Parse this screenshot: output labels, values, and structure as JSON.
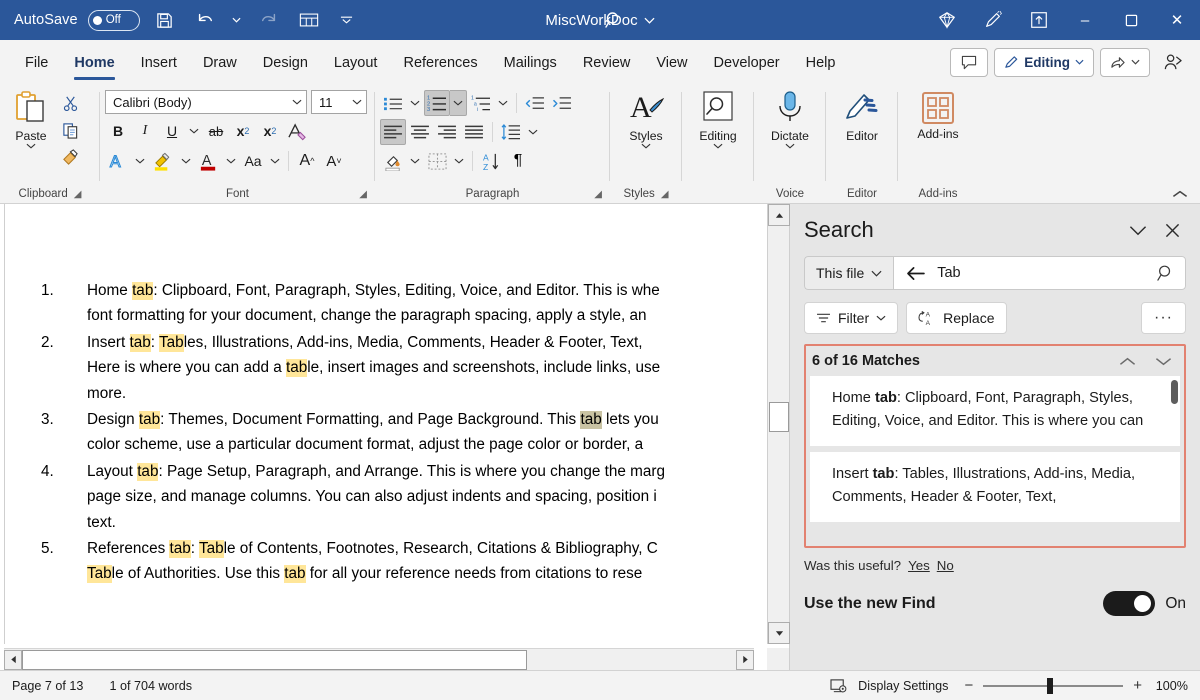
{
  "titlebar": {
    "autosave_label": "AutoSave",
    "autosave_state": "Off",
    "document_title": "MiscWorkDoc",
    "icons": [
      "save-icon",
      "undo-icon",
      "redo-icon",
      "table-icon",
      "customize-quick-access-toolbar-icon"
    ],
    "search_icon": "search-icon",
    "right_icons": [
      "diamond-icon",
      "pen-highlight-icon",
      "share-upload-icon"
    ],
    "window_minimize": "–",
    "window_maximize": "▫",
    "window_close": "✕"
  },
  "tabs": [
    {
      "label": "File",
      "active": false
    },
    {
      "label": "Home",
      "active": true
    },
    {
      "label": "Insert",
      "active": false
    },
    {
      "label": "Draw",
      "active": false
    },
    {
      "label": "Design",
      "active": false
    },
    {
      "label": "Layout",
      "active": false
    },
    {
      "label": "References",
      "active": false
    },
    {
      "label": "Mailings",
      "active": false
    },
    {
      "label": "Review",
      "active": false
    },
    {
      "label": "View",
      "active": false
    },
    {
      "label": "Developer",
      "active": false
    },
    {
      "label": "Help",
      "active": false
    }
  ],
  "tabstrip_right": {
    "comments_icon": "comment-icon",
    "editing_label": "Editing",
    "editing_icon": "pencil-icon",
    "share_icon": "share-icon",
    "catchup_icon": "person-add-icon"
  },
  "ribbon": {
    "groups": [
      {
        "name": "Clipboard",
        "label": "Clipboard",
        "has_dialog_launcher": true
      },
      {
        "name": "Font",
        "label": "Font",
        "has_dialog_launcher": true
      },
      {
        "name": "Paragraph",
        "label": "Paragraph",
        "has_dialog_launcher": true
      },
      {
        "name": "Styles",
        "label": "Styles",
        "has_dialog_launcher": true
      },
      {
        "name": "Editing",
        "label": "",
        "has_dialog_launcher": false
      },
      {
        "name": "Voice",
        "label": "Voice",
        "has_dialog_launcher": false
      },
      {
        "name": "Editor",
        "label": "Editor",
        "has_dialog_launcher": false
      },
      {
        "name": "Add-ins",
        "label": "Add-ins",
        "has_dialog_launcher": false
      }
    ],
    "clipboard": {
      "paste_label": "Paste",
      "cut_icon": "scissors-icon",
      "copy_icon": "copy-icon",
      "format_painter_icon": "format-painter-icon"
    },
    "font": {
      "font_name": "Calibri (Body)",
      "font_size": "11",
      "bold": "B",
      "italic": "I",
      "underline": "U",
      "strikethrough": "ab",
      "subscript": "x",
      "superscript": "x",
      "clear_formatting_icon": "clear-formatting-icon",
      "text_effects_icon": "text-effects-icon",
      "highlight_icon": "text-highlight-icon",
      "font_color_icon": "font-color-icon",
      "change_case": "Aa",
      "grow_font": "A",
      "shrink_font": "A"
    },
    "paragraph": {
      "bullets_icon": "bullet-list-icon",
      "numbering_icon": "numbered-list-icon",
      "multilevel_icon": "multilevel-list-icon",
      "decrease_indent_icon": "decrease-indent-icon",
      "increase_indent_icon": "increase-indent-icon",
      "align_left_icon": "align-left-icon",
      "align_center_icon": "align-center-icon",
      "align_right_icon": "align-right-icon",
      "justify_icon": "justify-icon",
      "line_spacing_icon": "line-spacing-icon",
      "shading_icon": "shading-icon",
      "borders_icon": "borders-icon",
      "sort_icon": "sort-icon",
      "show_marks_icon": "paragraph-marks-icon"
    },
    "styles": {
      "label": "Styles",
      "icon": "styles-icon"
    },
    "editing": {
      "label": "Editing",
      "icon": "find-icon"
    },
    "voice": {
      "label": "Dictate",
      "icon": "microphone-icon"
    },
    "editor": {
      "label": "Editor",
      "icon": "editor-pen-icon"
    },
    "addins": {
      "label": "Add-ins",
      "icon": "addins-grid-icon"
    },
    "collapse_icon": "collapse-ribbon-icon"
  },
  "document": {
    "items": [
      [
        {
          "t": "Home "
        },
        {
          "t": "tab",
          "hl": "match"
        },
        {
          "t": ": Clipboard, Font, Paragraph, Styles, Editing, Voice, and Editor. This is whe"
        },
        {
          "t": "\n"
        },
        {
          "t": "font formatting for your document, change the paragraph spacing, apply a style, an"
        }
      ],
      [
        {
          "t": "Insert "
        },
        {
          "t": "tab",
          "hl": "match"
        },
        {
          "t": ": "
        },
        {
          "t": "Tab",
          "hl": "match"
        },
        {
          "t": "les, Illustrations, Add-ins, Media, Comments, Header & Footer, Text,"
        },
        {
          "t": "\n"
        },
        {
          "t": "Here is where you can add a "
        },
        {
          "t": "tab",
          "hl": "match"
        },
        {
          "t": "le, insert images and screenshots, include links, use"
        },
        {
          "t": "\n"
        },
        {
          "t": "more."
        }
      ],
      [
        {
          "t": "Design "
        },
        {
          "t": "tab",
          "hl": "match"
        },
        {
          "t": ": Themes, Document Formatting, and Page Background. This "
        },
        {
          "t": "tab",
          "hl": "selected"
        },
        {
          "t": " lets you"
        },
        {
          "t": "\n"
        },
        {
          "t": "color scheme, use a particular document format, adjust the page color or border, a"
        }
      ],
      [
        {
          "t": "Layout "
        },
        {
          "t": "tab",
          "hl": "match"
        },
        {
          "t": ": Page Setup, Paragraph, and Arrange. This is where you change the marg"
        },
        {
          "t": "\n"
        },
        {
          "t": "page size, and manage columns. You can also adjust indents and spacing, position i"
        },
        {
          "t": "\n"
        },
        {
          "t": "text."
        }
      ],
      [
        {
          "t": "References "
        },
        {
          "t": "tab",
          "hl": "match"
        },
        {
          "t": ": "
        },
        {
          "t": "Tab",
          "hl": "match"
        },
        {
          "t": "le of Contents, Footnotes, Research, Citations & Bibliography, C"
        },
        {
          "t": "\n"
        },
        {
          "t": "Tab",
          "hl": "match"
        },
        {
          "t": "le of Authorities. Use this "
        },
        {
          "t": "tab",
          "hl": "match"
        },
        {
          "t": " for all your reference needs from citations to rese"
        }
      ]
    ]
  },
  "search_pane": {
    "title": "Search",
    "collapse_icon": "chevron-down-icon",
    "close_icon": "close-icon",
    "scope_label": "This file",
    "scope_caret_icon": "chevron-down-icon",
    "back_icon": "arrow-left-icon",
    "query_value": "Tab",
    "query_placeholder": "Search",
    "search_icon": "search-icon",
    "filter_label": "Filter",
    "filter_icon": "filter-icon",
    "replace_label": "Replace",
    "replace_icon": "replace-icon",
    "more_label": "···",
    "match_count_label": "6 of 16 Matches",
    "prev_icon": "chevron-up-icon",
    "next_icon": "chevron-down-icon",
    "results": [
      {
        "prefix": "Home ",
        "bold": "tab",
        "suffix": ": Clipboard, Font, Paragraph, Styles, Editing, Voice, and Editor. This is where you can"
      },
      {
        "prefix": "Insert ",
        "bold": "tab",
        "suffix": ": Tables, Illustrations, Add-ins, Media, Comments, Header & Footer, Text,"
      }
    ],
    "feedback_question": "Was this useful?",
    "feedback_yes": "Yes",
    "feedback_no": "No",
    "new_find_label": "Use the new Find",
    "new_find_state": "On"
  },
  "statusbar": {
    "page_label": "Page 7 of 13",
    "words_label": "1 of 704 words",
    "display_settings_label": "Display Settings",
    "display_settings_icon": "display-settings-icon",
    "zoom_out": "−",
    "zoom_in": "+",
    "zoom_value": "100%"
  },
  "colors": {
    "titlebar_bg": "#2b579a",
    "ribbon_bg": "#f3f3f3",
    "accent": "#2b579a",
    "highlight_yellow": "#ffe699",
    "highlight_selected": "#c9c3a3",
    "results_border": "#e28170",
    "pane_bg": "#e6e6e6"
  }
}
